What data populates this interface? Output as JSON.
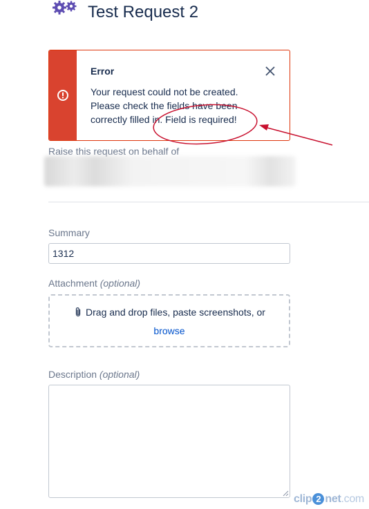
{
  "page": {
    "title": "Test Request 2"
  },
  "error": {
    "title": "Error",
    "message": "Your request could not be created. Please check the fields have been correctly filled in. Field is required!"
  },
  "behalf": {
    "label": "Raise this request on behalf of"
  },
  "summary": {
    "label": "Summary",
    "value": "1312"
  },
  "attachment": {
    "label": "Attachment",
    "optional": "(optional)",
    "drop_text": "Drag and drop files, paste screenshots, or",
    "browse_text": "browse"
  },
  "description": {
    "label": "Description",
    "optional": "(optional)",
    "value": ""
  },
  "watermark": {
    "prefix": "clip",
    "mid": "2",
    "suffix": "net",
    "tld": ".com"
  },
  "colors": {
    "error_red": "#d9432f",
    "annotation_red": "#c8102e",
    "link_blue": "#0052cc",
    "brand_purple": "#5e4db2"
  },
  "icons": {
    "header": "gears-icon",
    "error": "error-icon",
    "close": "close-icon",
    "attachment": "paperclip-icon"
  }
}
